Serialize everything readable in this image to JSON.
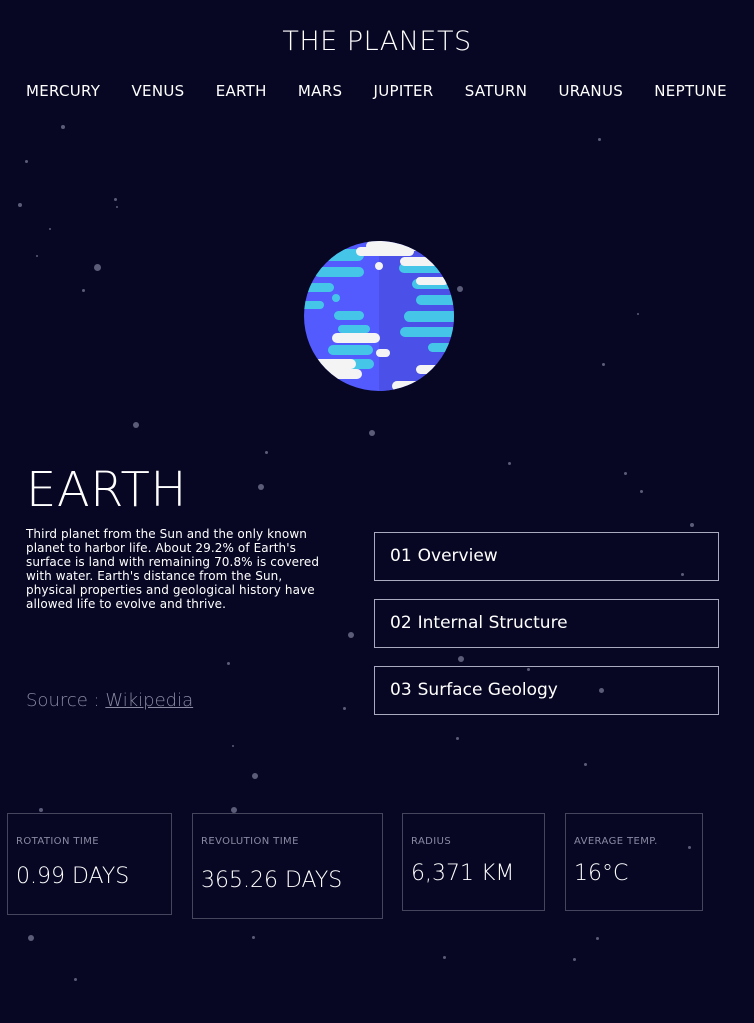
{
  "header": {
    "title": "THE PLANETS",
    "nav": [
      "MERCURY",
      "VENUS",
      "EARTH",
      "MARS",
      "JUPITER",
      "SATURN",
      "URANUS",
      "NEPTUNE"
    ]
  },
  "planet": {
    "name": "EARTH",
    "description": "Third planet from the Sun and the only known planet to harbor life. About 29.2% of Earth's surface is land with remaining 70.8% is covered with water. Earth's distance from the Sun, physical properties and geological history have allowed life to evolve and thrive.",
    "source_prefix": "Source : ",
    "source_link": "Wikipedia",
    "image_icon": "earth-planet-illustration"
  },
  "tabs": [
    {
      "num": "01",
      "label": "Overview"
    },
    {
      "num": "02",
      "label": "Internal Structure"
    },
    {
      "num": "03",
      "label": "Surface Geology"
    }
  ],
  "stats": [
    {
      "label": "ROTATION TIME",
      "value": "0.99 DAYS"
    },
    {
      "label": "REVOLUTION TIME",
      "value": "365.26 DAYS"
    },
    {
      "label": "RADIUS",
      "value": "6,371 KM"
    },
    {
      "label": "AVERAGE TEMP.",
      "value": "16°C"
    }
  ],
  "colors": {
    "background": "#070724",
    "border": "#a9aac0",
    "muted_text": "#8a8aa3",
    "earth_blue": "#545bfe",
    "earth_cyan": "#45c6e9",
    "earth_cloud": "#f4f4f4"
  }
}
